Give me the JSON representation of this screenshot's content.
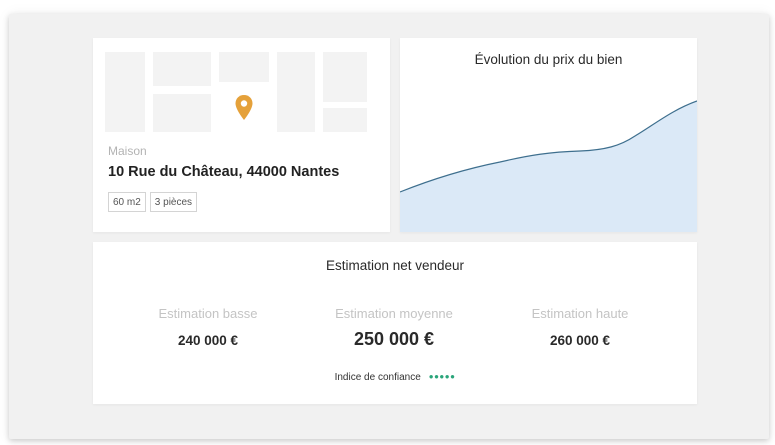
{
  "property": {
    "type": "Maison",
    "address": "10 Rue du Château, 44000 Nantes",
    "tags": [
      "60 m2",
      "3 pièces"
    ],
    "pin_color": "#e5a13a"
  },
  "chart": {
    "title": "Évolution du prix du bien",
    "line_color": "#3e6f8e",
    "fill_color": "#dbe9f7"
  },
  "estimation": {
    "title": "Estimation net vendeur",
    "low": {
      "label": "Estimation basse",
      "value": "240 000 €"
    },
    "mid": {
      "label": "Estimation moyenne",
      "value": "250 000 €"
    },
    "high": {
      "label": "Estimation haute",
      "value": "260 000 €"
    },
    "confidence_label": "Indice de confiance",
    "confidence_dots": "●●●●●",
    "confidence_color": "#2aa57a"
  }
}
